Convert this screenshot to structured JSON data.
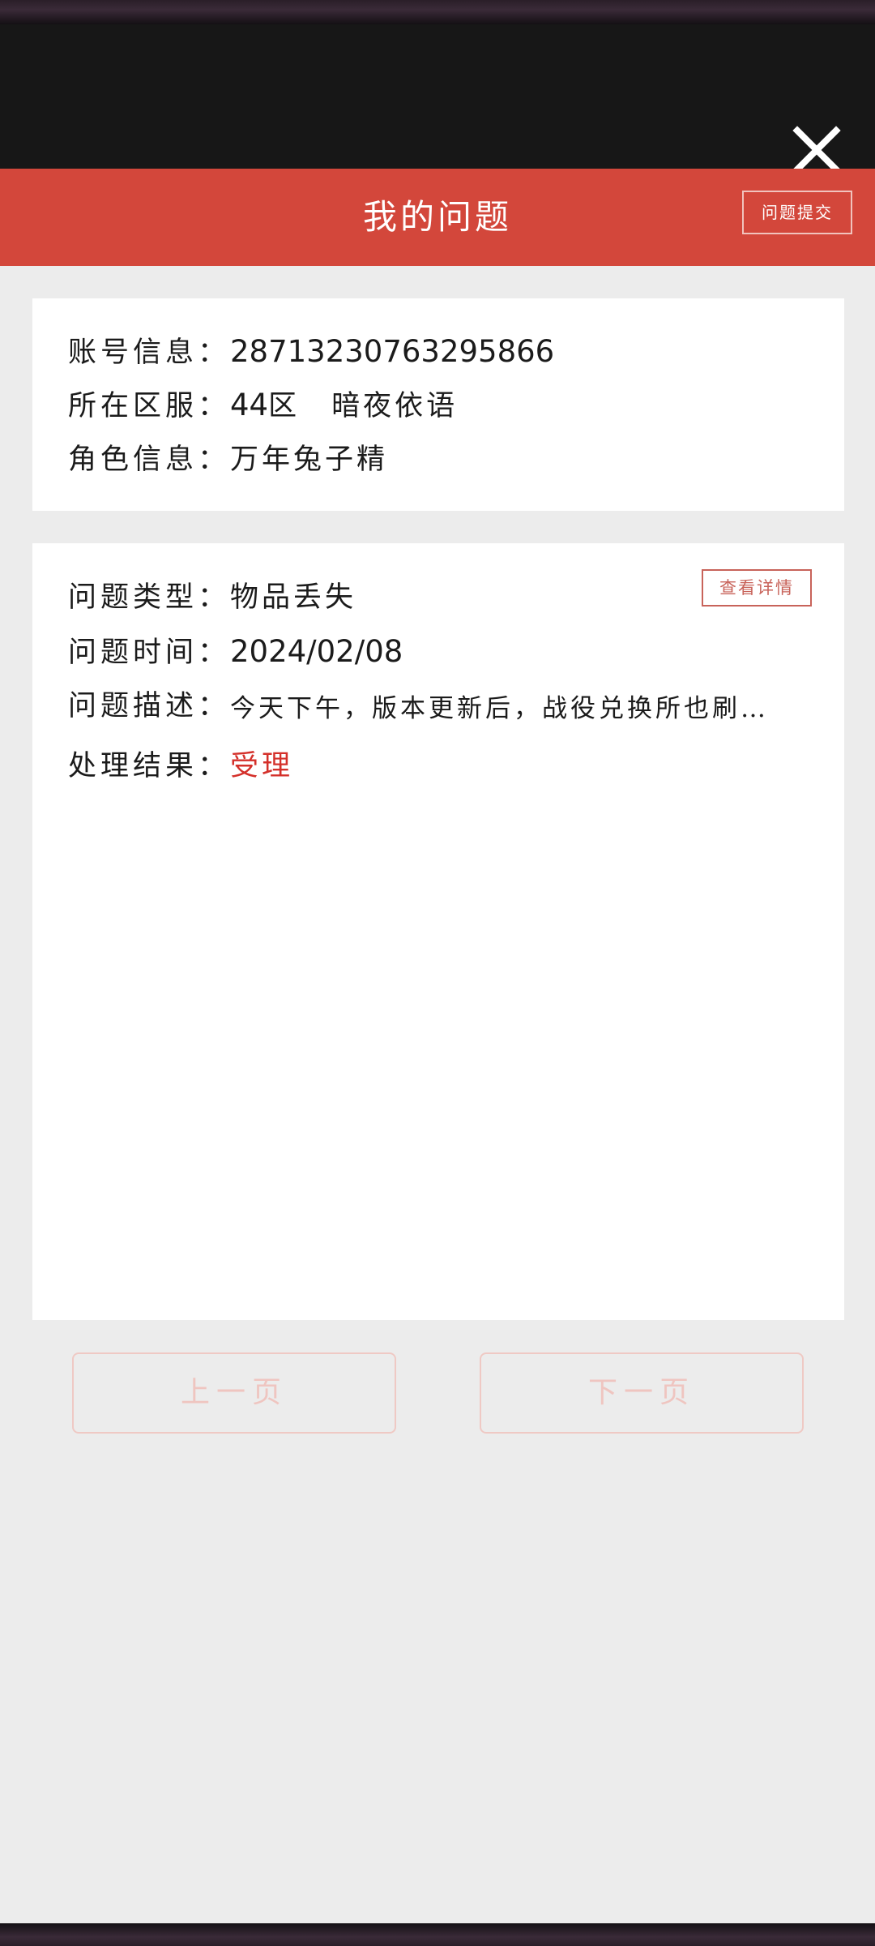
{
  "header": {
    "title": "我的问题",
    "submit_label": "问题提交",
    "close_icon": "close-icon"
  },
  "account": {
    "account_label": "账号信息：",
    "account_value": "28713230763295866",
    "server_label": "所在区服：",
    "server_num": "44",
    "server_value": "区　暗夜依语",
    "role_label": "角色信息：",
    "role_value": "万年兔子精"
  },
  "issue": {
    "detail_label": "查看详情",
    "type_label": "问题类型：",
    "type_value": "物品丢失",
    "time_label": "问题时间：",
    "time_value": "2024/02/08",
    "desc_label": "问题描述：",
    "desc_value": "今天下午，版本更新后，战役兑换所也刷…",
    "result_label": "处理结果：",
    "result_value": "受理"
  },
  "pager": {
    "prev_label": "上一页",
    "next_label": "下一页"
  },
  "colors": {
    "accent": "#d3473b",
    "result": "#d4302a",
    "header_dark": "#171717",
    "background": "#ececec"
  }
}
